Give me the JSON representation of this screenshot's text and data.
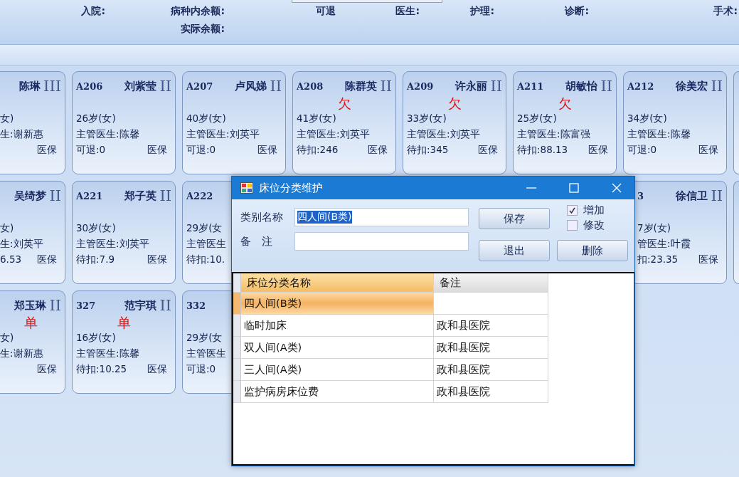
{
  "header": {
    "labels": [
      "入院:",
      "病种内余额:",
      "可退",
      "医生:",
      "护理:",
      "诊断:",
      "手术:"
    ],
    "second_row": [
      "实际余额:"
    ]
  },
  "bed_rows": [
    {
      "left": [
        {
          "kind": "cut",
          "name": "陈琳",
          "grade": "III",
          "age": "女)",
          "doctor": "生:谢新惠",
          "insurance": "医保"
        },
        {
          "kind": "full",
          "room": "A206",
          "name": "刘紫莹",
          "grade": "II",
          "age": "26岁(女)",
          "doctor": "主管医生:陈馨",
          "balance": "可退:0",
          "insurance": "医保"
        },
        {
          "kind": "full",
          "room": "A207",
          "name": "卢风娣",
          "grade": "II",
          "age": "40岁(女)",
          "doctor": "主管医生:刘英平",
          "balance": "可退:0",
          "insurance": "医保"
        },
        {
          "kind": "full",
          "room": "A208",
          "name": "陈群英",
          "grade": "II",
          "flag": "欠",
          "age": "41岁(女)",
          "doctor": "主管医生:刘英平",
          "balance": "待扣:246",
          "insurance": "医保"
        },
        {
          "kind": "full",
          "room": "A209",
          "name": "许永丽",
          "grade": "II",
          "flag": "欠",
          "age": "33岁(女)",
          "doctor": "主管医生:刘英平",
          "balance": "待扣:345",
          "insurance": "医保"
        },
        {
          "kind": "full",
          "room": "A211",
          "name": "胡敏怡",
          "grade": "II",
          "flag": "欠",
          "age": "25岁(女)",
          "doctor": "主管医生:陈富强",
          "balance": "待扣:88.13",
          "insurance": "医保"
        },
        {
          "kind": "full",
          "room": "A212",
          "name": "徐美宏",
          "grade": "II",
          "age": "34岁(女)",
          "doctor": "主管医生:陈馨",
          "balance": "可退:0",
          "insurance": "医保"
        },
        {
          "kind": "edge"
        }
      ],
      "right": []
    },
    {
      "left": [
        {
          "kind": "cut",
          "name": "吴绮梦",
          "grade": "II",
          "age": "女)",
          "doctor": "生:刘英平",
          "balance": "6.53",
          "insurance": "医保"
        },
        {
          "kind": "full",
          "room": "A221",
          "name": "郑子英",
          "grade": "II",
          "age": "30岁(女)",
          "doctor": "主管医生:刘英平",
          "balance": "待扣:7.9",
          "insurance": "医保"
        },
        {
          "kind": "full",
          "room": "A222",
          "age": "29岁(女",
          "doctor": "主管医生",
          "balance": "待扣:10."
        }
      ],
      "right": [
        {
          "kind": "behind",
          "room": "3",
          "name": "徐信卫",
          "grade": "II",
          "age": "7岁(女)",
          "doctor": "管医生:叶霞",
          "balance": "扣:23.35",
          "insurance": "医保"
        },
        {
          "kind": "edge"
        }
      ]
    },
    {
      "left": [
        {
          "kind": "cut",
          "name": "郑玉琳",
          "grade": "II",
          "flag": "单",
          "age": "女)",
          "doctor": "生:谢新惠",
          "insurance": "医保"
        },
        {
          "kind": "full",
          "room": "327",
          "name": "范宇琪",
          "grade": "II",
          "flag": "单",
          "age": "16岁(女)",
          "doctor": "主管医生:陈馨",
          "balance": "待扣:10.25",
          "insurance": "医保"
        },
        {
          "kind": "full",
          "room": "332",
          "age": "29岁(女",
          "doctor": "主管医生",
          "balance": "可退:0"
        }
      ],
      "right": []
    }
  ],
  "dialog": {
    "title": "床位分类维护",
    "fields": [
      {
        "label": "类别名称",
        "value": "四人间(B类)",
        "selected": true
      },
      {
        "label": "备　注"
      }
    ],
    "buttons": [
      "保存",
      "退出",
      "删除"
    ],
    "checkboxes": [
      {
        "label": "增加",
        "checked": true
      },
      {
        "label": "修改",
        "checked": false
      }
    ],
    "columns": [
      {
        "label": "床位分类名称",
        "selected": true
      },
      {
        "label": "备注",
        "selected": false
      }
    ],
    "rows": [
      {
        "name": "四人间(B类)",
        "selected": true
      },
      {
        "name": "临时加床",
        "note": "政和县医院",
        "selected": false
      },
      {
        "name": "双人间(A类)",
        "note": "政和县医院",
        "selected": false
      },
      {
        "name": "三人间(A类)",
        "note": "政和县医院",
        "selected": false
      },
      {
        "name": "监护病房床位费",
        "note": "政和县医院",
        "selected": false
      }
    ]
  }
}
